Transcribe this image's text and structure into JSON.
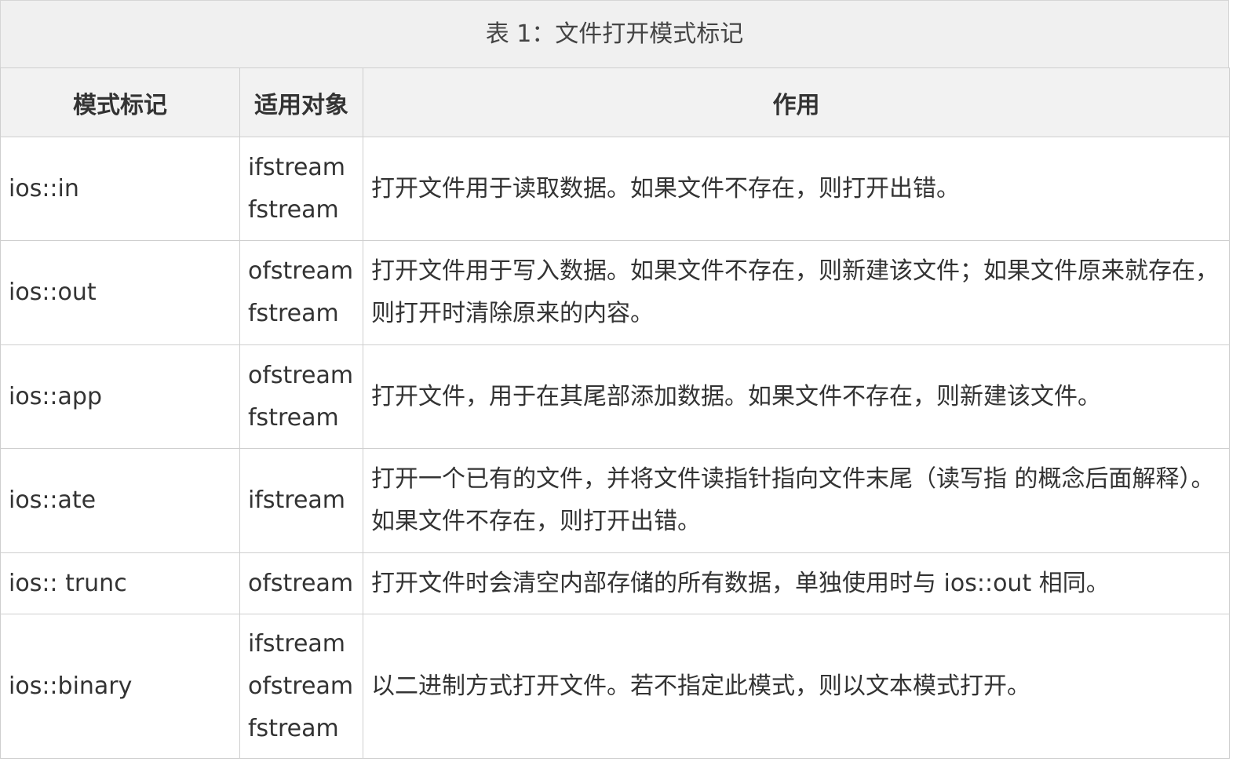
{
  "table": {
    "caption": "表 1：文件打开模式标记",
    "headers": {
      "mode": "模式标记",
      "target": "适用对象",
      "effect": "作用"
    },
    "rows": [
      {
        "mode": "ios::in",
        "targets": [
          "ifstream",
          "fstream"
        ],
        "effect": "打开文件用于读取数据。如果文件不存在，则打开出错。"
      },
      {
        "mode": "ios::out",
        "targets": [
          "ofstream",
          "fstream"
        ],
        "effect": "打开文件用于写入数据。如果文件不存在，则新建该文件；如果文件原来就存在，则打开时清除原来的内容。"
      },
      {
        "mode": "ios::app",
        "targets": [
          "ofstream",
          "fstream"
        ],
        "effect": "打开文件，用于在其尾部添加数据。如果文件不存在，则新建该文件。"
      },
      {
        "mode": "ios::ate",
        "targets": [
          "ifstream"
        ],
        "effect": "打开一个已有的文件，并将文件读指针指向文件末尾（读写指 的概念后面解释）。如果文件不存在，则打开出错。"
      },
      {
        "mode": "ios:: trunc",
        "targets": [
          "ofstream"
        ],
        "effect": "打开文件时会清空内部存储的所有数据，单独使用时与 ios::out 相同。"
      },
      {
        "mode": "ios::binary",
        "targets": [
          "ifstream",
          "ofstream",
          "fstream"
        ],
        "effect": "以二进制方式打开文件。若不指定此模式，则以文本模式打开。"
      }
    ]
  }
}
